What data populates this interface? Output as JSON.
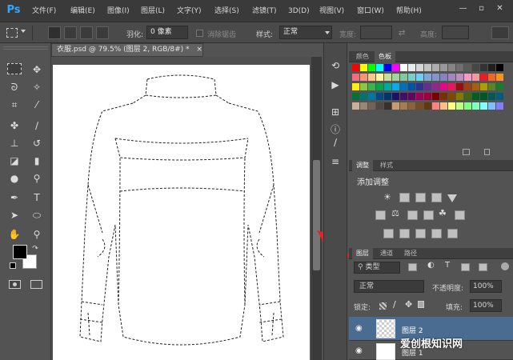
{
  "app": {
    "logo": "Ps"
  },
  "menu": [
    "文件(F)",
    "编辑(E)",
    "图像(I)",
    "图层(L)",
    "文字(Y)",
    "选择(S)",
    "滤镜(T)",
    "3D(D)",
    "视图(V)",
    "窗口(W)",
    "帮助(H)"
  ],
  "window_controls": {
    "minimize": "—",
    "restore": "▫",
    "close": "✕"
  },
  "options": {
    "feather_label": "羽化:",
    "feather_value": "0 像素",
    "antialias_label": "消除锯齿",
    "style_label": "样式:",
    "style_value": "正常",
    "width_label": "宽度:",
    "height_label": "高度:"
  },
  "document": {
    "tab_title": "衣服.psd @ 79.5% (图层 2, RGB/8#) *",
    "tab_close": "×"
  },
  "color_panel": {
    "tabs": [
      "颜色",
      "色板"
    ],
    "active_tab": 1
  },
  "adjust_panel": {
    "tabs": [
      "调整",
      "样式"
    ],
    "active_tab": 0,
    "title": "添加调整"
  },
  "layers_panel": {
    "tabs": [
      "图层",
      "通道",
      "路径"
    ],
    "active_tab": 0,
    "filter_value": "类型",
    "blend_mode": "正常",
    "opacity_label": "不透明度:",
    "opacity_value": "100%",
    "lock_label": "锁定:",
    "fill_label": "填充:",
    "fill_value": "100%",
    "layers": [
      {
        "name": "图层 2",
        "visible": true,
        "selected": true
      },
      {
        "name": "图层 1",
        "visible": true,
        "selected": false
      }
    ]
  },
  "watermark": "爱创根知识网",
  "colors": {
    "accent": "#31a8ff",
    "arrow": "#e0242a",
    "selected_layer": "#4b6c91"
  }
}
